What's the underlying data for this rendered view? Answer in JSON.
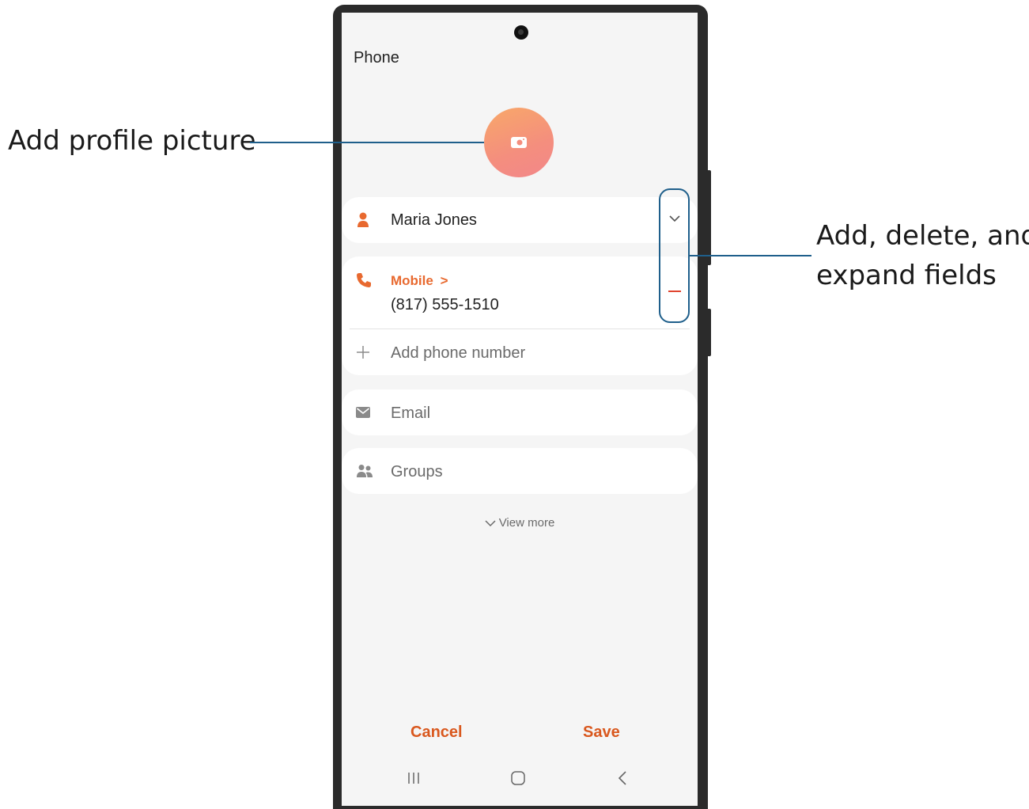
{
  "callouts": {
    "profile_picture": "Add profile picture",
    "fields_line1": "Add, delete, and",
    "fields_line2": "expand fields"
  },
  "screen": {
    "app_title": "Phone",
    "name_field": {
      "value": "Maria Jones"
    },
    "phone_field": {
      "type_label": "Mobile",
      "type_chevron": ">",
      "value": "(817) 555-1510"
    },
    "add_phone": {
      "placeholder": "Add phone number"
    },
    "email": {
      "placeholder": "Email"
    },
    "groups": {
      "placeholder": "Groups"
    },
    "view_more": "View more",
    "buttons": {
      "cancel": "Cancel",
      "save": "Save"
    }
  },
  "icons": {
    "avatar": "camera-icon",
    "name": "person-icon",
    "phone": "phone-icon",
    "add": "plus-icon",
    "email": "mail-icon",
    "groups": "people-icon",
    "expand": "chevron-down-icon",
    "delete": "minus-icon"
  },
  "colors": {
    "accent": "#e8692f",
    "button_text": "#d9581e",
    "callout_line": "#1f5f8b",
    "avatar_gradient": [
      "#f8a869",
      "#f2878a"
    ]
  }
}
